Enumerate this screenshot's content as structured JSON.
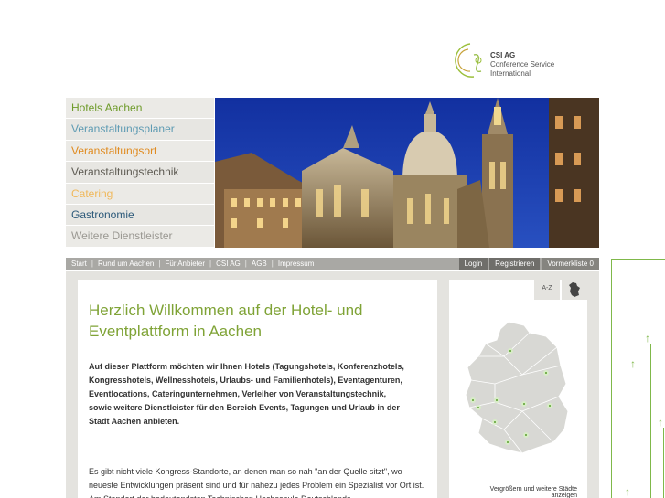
{
  "logo": {
    "line1": "CSI AG",
    "line2": "Conference Service",
    "line3": "International"
  },
  "nav": {
    "items": [
      {
        "label": "Hotels Aachen",
        "color": "#6e9b2a"
      },
      {
        "label": "Veranstaltungsplaner",
        "color": "#5e9bb3"
      },
      {
        "label": "Veranstaltungsort",
        "color": "#e08a1e"
      },
      {
        "label": "Veranstaltungstechnik",
        "color": "#5d5a52"
      },
      {
        "label": "Catering",
        "color": "#f0b85a"
      },
      {
        "label": "Gastronomie",
        "color": "#2d5a7a"
      },
      {
        "label": "Weitere Dienstleister",
        "color": "#9a9892"
      }
    ]
  },
  "menu": {
    "links": [
      "Start",
      "Rund um Aachen",
      "Für Anbieter",
      "CSI AG",
      "AGB",
      "Impressum"
    ],
    "login": "Login",
    "register": "Registrieren",
    "merkliste": "Vormerkliste 0"
  },
  "main": {
    "title": "Herzlich Willkommen auf der Hotel- und Eventplattform in Aachen",
    "intro": "Auf dieser Plattform möchten wir Ihnen Hotels (Tagungshotels, Konferenzhotels, Kongresshotels, Wellnesshotels, Urlaubs- und Familienhotels), Eventagenturen, Eventlocations, Cateringunternehmen, Verleiher von Veranstaltungstechnik, sowie weitere Dienstleister für den Bereich Events, Tagungen und Urlaub in der Stadt Aachen anbieten.",
    "body": "Es gibt nicht viele Kongress-Standorte, an denen man so nah \"an der Quelle sitzt\", wo neueste Entwicklungen präsent sind und für nahezu jedes Problem ein Spezialist vor Ort ist. Am Standort der bedeutendsten Technischen Hochschule Deutschlands"
  },
  "mapbox": {
    "tab_az": "A-Z",
    "caption": "Vergrößern und weitere Städte anzeigen"
  },
  "colors": {
    "accent": "#7fa336",
    "menubar": "#a9a8a4",
    "deco": "#7fb84a"
  }
}
